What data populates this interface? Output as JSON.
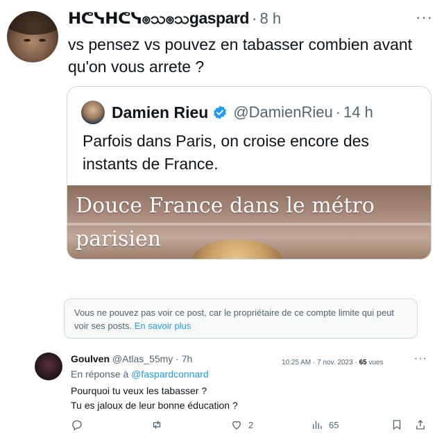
{
  "tweet": {
    "author_name": "ᕼᕦᓭᕼᕦᓭၜသၜသgaspard",
    "separator": "·",
    "time": "8 h",
    "more": "···",
    "text": "vs pensez vs pouvez en tabasser combien avant qu'on vous arrete ?"
  },
  "quote": {
    "name": "Damien Rieu",
    "handle": "@DamienRieu",
    "separator": "·",
    "time": "14 h",
    "text": "Parfois dans Paris, on croise encore des instants de France.",
    "media_caption_line1": "Douce France dans le métro",
    "media_caption_line2": "parisien"
  },
  "notice": {
    "text": "Vous ne pouvez pas voir ce post, car le propriétaire de ce compte limite qui peut voir ses posts.",
    "link": "En savoir plus"
  },
  "reply": {
    "name": "Goulven",
    "handle": "@Atlas_55my",
    "separator": "·",
    "time": "7h",
    "meta_time": "10:25 AM · 7 nov. 2023 · ",
    "meta_views": "65",
    "meta_views_label": " vues",
    "more": "···",
    "reply_to_prefix": "En réponse à ",
    "reply_to_handle": "@faspardconnard",
    "line1": "Pourquoi tu veux les tabasser ?",
    "line2": "Tu es jaloux de leur bonne éducation ?",
    "likes": "2",
    "views": "65"
  },
  "colors": {
    "accent": "#1d9bf0",
    "secondary_text": "#536471",
    "border": "#cfd9de"
  }
}
